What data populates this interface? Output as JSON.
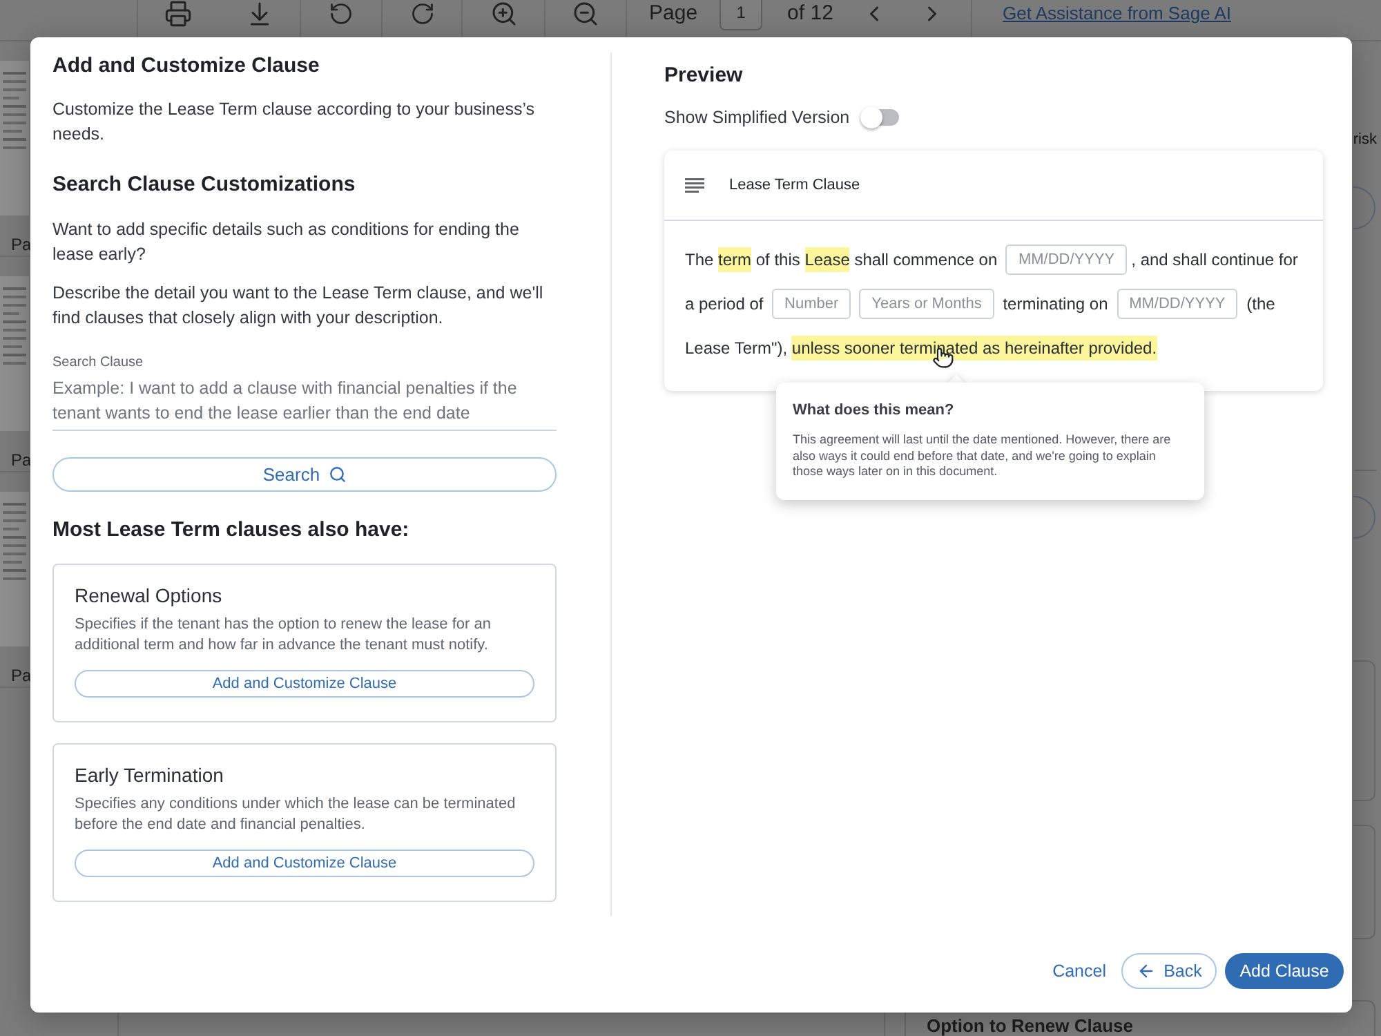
{
  "toolbar": {
    "page_label": "Page",
    "page_input": "1",
    "page_total": "of 12",
    "assist_link": "Get Assistance from Sage AI"
  },
  "thumbnails": [
    {
      "label": "Pa"
    },
    {
      "label": "Pa"
    },
    {
      "label": "Pa"
    }
  ],
  "side_panel": {
    "text": "risk",
    "card_title": "Option to Renew Clause"
  },
  "dialog": {
    "left": {
      "title": "Add and Customize Clause",
      "intro": "Customize the Lease Term clause according to your business’s needs.",
      "search_heading": "Search Clause Customizations",
      "paragraphs": [
        "Want to add specific details such as conditions for ending the lease early?",
        "Describe the detail you want to the Lease Term clause, and we'll find clauses that closely align with your description."
      ],
      "search_field": {
        "label": "Search Clause",
        "placeholder": "Example: I want to add a clause with financial penalties if the tenant wants to end the lease earlier than the end date"
      },
      "search_button": "Search",
      "suggestions_heading": "Most Lease Term clauses also have:",
      "suggestions": [
        {
          "title": "Renewal Options",
          "description": "Specifies if the tenant has the option to renew the lease for an additional term and how far in advance the tenant must notify.",
          "button": "Add and Customize Clause"
        },
        {
          "title": "Early Termination",
          "description": "Specifies any conditions under which the lease can be terminated before the end date and financial penalties.",
          "button": "Add and Customize Clause"
        }
      ]
    },
    "preview": {
      "title": "Preview",
      "simplified_toggle": {
        "label": "Show Simplified Version",
        "on": false
      },
      "clause": {
        "title": "Lease Term Clause",
        "lines": [
          [
            {
              "kind": "text",
              "text": "The "
            },
            {
              "kind": "highlight",
              "text": "term"
            },
            {
              "kind": "text",
              "text": " of this "
            },
            {
              "kind": "highlight",
              "text": "Lease"
            },
            {
              "kind": "text",
              "text": " shall commence on "
            },
            {
              "kind": "field",
              "placeholder": "MM/DD/YYYY"
            },
            {
              "kind": "text",
              "text": ", and shall continue for"
            }
          ],
          [
            {
              "kind": "text",
              "text": "a period of "
            },
            {
              "kind": "field",
              "placeholder": "Number"
            },
            {
              "kind": "field",
              "placeholder": "Years or Months"
            },
            {
              "kind": "text",
              "text": " terminating on "
            },
            {
              "kind": "field",
              "placeholder": "MM/DD/YYYY"
            },
            {
              "kind": "text",
              "text": " (the"
            }
          ],
          [
            {
              "kind": "text",
              "text": "Lease Term\"), "
            },
            {
              "kind": "highlight",
              "text": "unless sooner terminated as hereinafter provided."
            }
          ]
        ]
      },
      "tooltip": {
        "title": "What does this mean?",
        "text": "This agreement will last until the date mentioned. However, there are also ways it could end before that date, and we're going to explain those ways later on in this document."
      }
    },
    "footer": {
      "cancel": "Cancel",
      "back": "Back",
      "submit": "Add Clause"
    }
  }
}
